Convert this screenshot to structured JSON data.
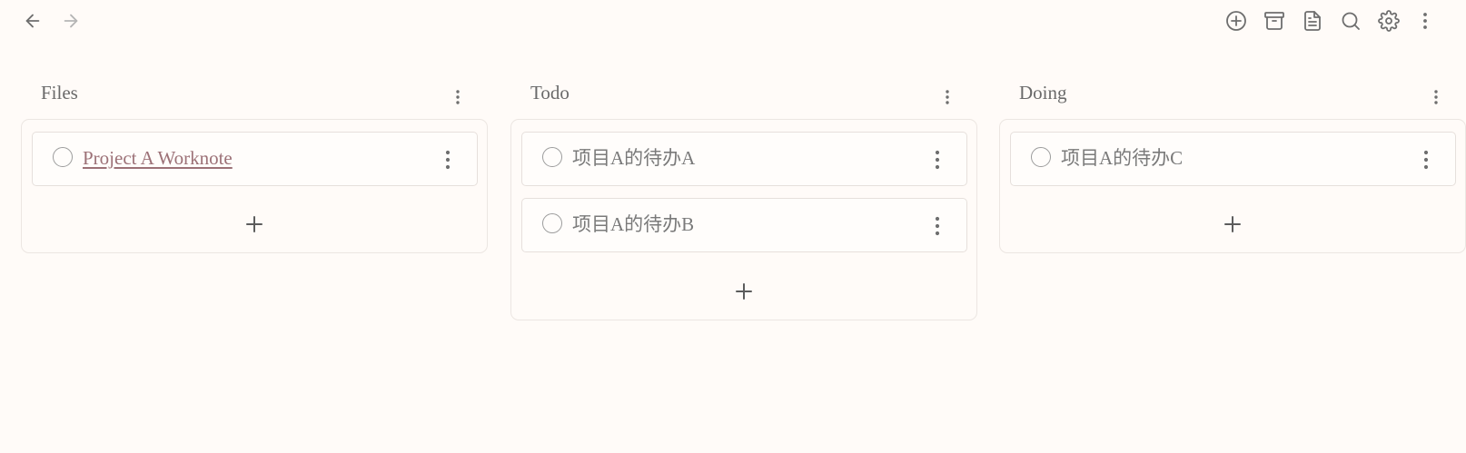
{
  "toolbar": {
    "left_icons": [
      "back-arrow-icon",
      "forward-arrow-icon"
    ],
    "right_icons": [
      "add-circle-icon",
      "archive-icon",
      "document-icon",
      "search-icon",
      "gear-icon",
      "more-vertical-icon"
    ]
  },
  "colors": {
    "background": "#fffbf8",
    "border": "#ece6e2",
    "link": "#9c7177",
    "icon": "#6e6e6e"
  },
  "board": {
    "columns": [
      {
        "title": "Files",
        "cards": [
          {
            "title": "Project A Worknote",
            "is_link": true
          }
        ]
      },
      {
        "title": "Todo",
        "cards": [
          {
            "title": "项目A的待办A",
            "is_link": false
          },
          {
            "title": "项目A的待办B",
            "is_link": false
          }
        ]
      },
      {
        "title": "Doing",
        "cards": [
          {
            "title": "项目A的待办C",
            "is_link": false
          }
        ]
      }
    ]
  }
}
